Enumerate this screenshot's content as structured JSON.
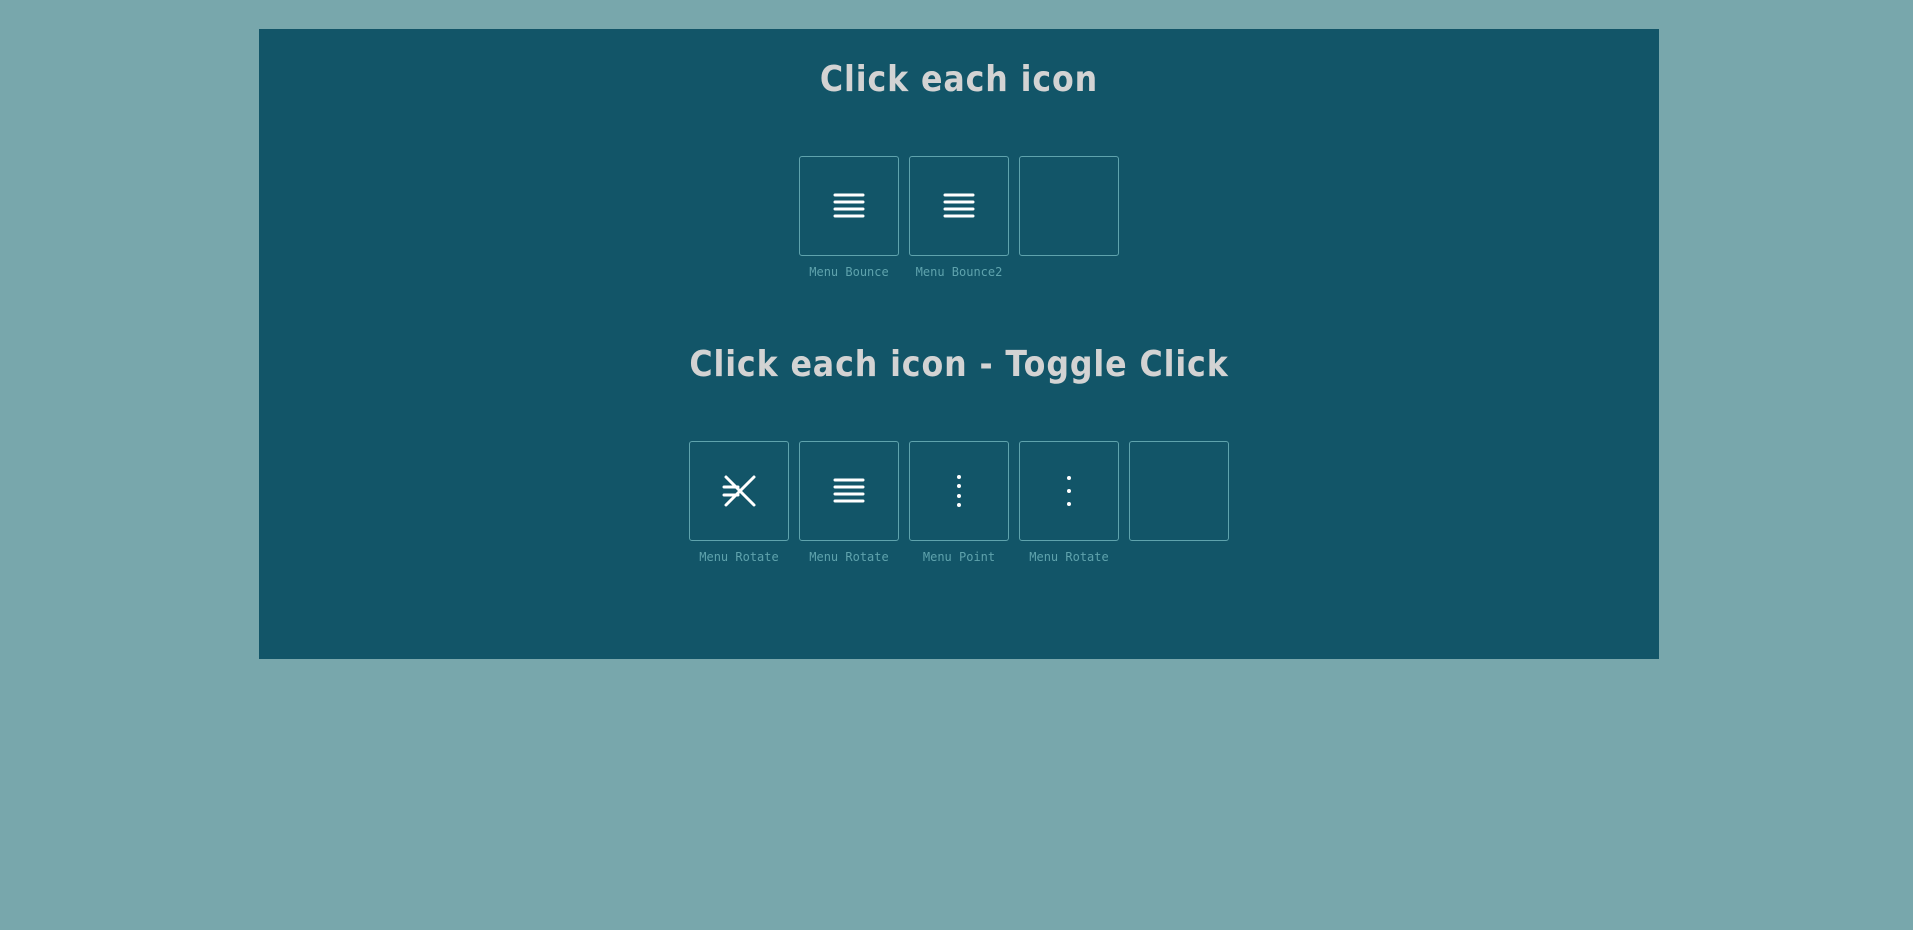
{
  "section1": {
    "title": "Click each icon",
    "icons": [
      {
        "caption": "Menu Bounce",
        "icon": "hamburger-icon"
      },
      {
        "caption": "Menu Bounce2",
        "icon": "hamburger-icon"
      },
      {
        "caption": "",
        "icon": "empty"
      }
    ]
  },
  "section2": {
    "title": "Click each icon - Toggle Click",
    "icons": [
      {
        "caption": "Menu Rotate",
        "icon": "menu-close-transition-icon"
      },
      {
        "caption": "Menu Rotate",
        "icon": "hamburger-icon"
      },
      {
        "caption": "Menu Point",
        "icon": "vertical-dots-icon"
      },
      {
        "caption": "Menu Rotate",
        "icon": "vertical-dots-icon"
      },
      {
        "caption": "",
        "icon": "empty"
      }
    ]
  },
  "colors": {
    "page_background": "#78a7ac",
    "panel_background": "#125568",
    "title_text": "#d3d3d3",
    "border_and_caption": "#5fa3ad",
    "icon_stroke": "#ffffff"
  }
}
